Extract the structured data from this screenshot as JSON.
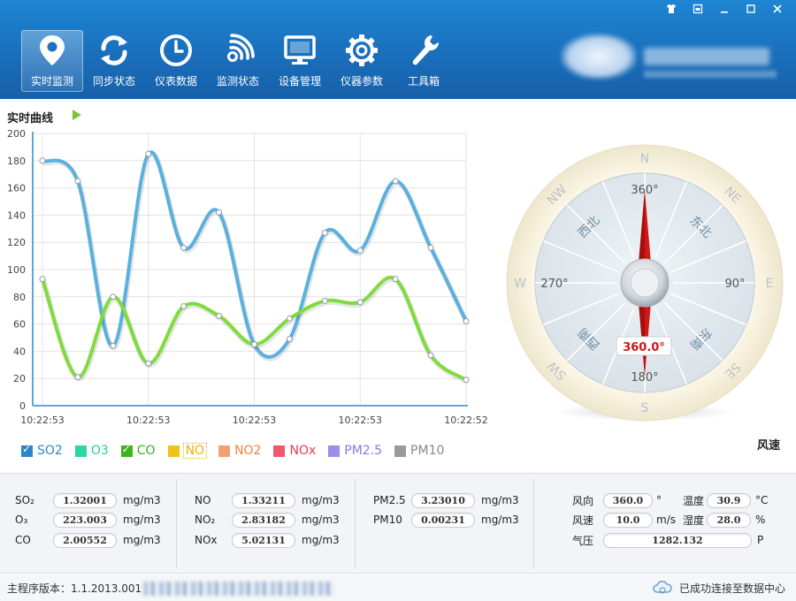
{
  "window_controls": [
    "shirt-icon",
    "restore-small-icon",
    "minimize-icon",
    "maximize-icon",
    "close-icon"
  ],
  "toolbar": {
    "items": [
      {
        "label": "实时监测",
        "icon": "location-pin-icon",
        "active": true
      },
      {
        "label": "同步状态",
        "icon": "sync-icon",
        "active": false
      },
      {
        "label": "仪表数据",
        "icon": "clock-icon",
        "active": false
      },
      {
        "label": "监测状态",
        "icon": "signal-icon",
        "active": false
      },
      {
        "label": "设备管理",
        "icon": "monitor-icon",
        "active": false
      },
      {
        "label": "仪器参数",
        "icon": "gear-icon",
        "active": false
      },
      {
        "label": "工具箱",
        "icon": "wrench-icon",
        "active": false
      }
    ]
  },
  "section_title": "实时曲线",
  "chart_data": {
    "type": "line",
    "title": "",
    "x": [
      "10:22:53",
      "",
      "",
      "",
      "",
      "",
      "",
      "",
      "",
      "",
      "",
      "",
      "",
      "",
      "",
      "",
      ""
    ],
    "x_tick_labels": [
      "10:22:53",
      "10:22:53",
      "10:22:53",
      "10:22:53",
      "10:22:52"
    ],
    "ylim": [
      0,
      200
    ],
    "yticks": [
      0,
      20,
      40,
      60,
      80,
      100,
      120,
      140,
      160,
      180,
      200
    ],
    "grid": true,
    "series": [
      {
        "name": "SO2",
        "color": "#5ab0de",
        "values": [
          180,
          165,
          44,
          185,
          116,
          142,
          45,
          49,
          127,
          114,
          165,
          116,
          62
        ]
      },
      {
        "name": "CO",
        "color": "#7fdc3c",
        "values": [
          93,
          21,
          80,
          31,
          73,
          66,
          45,
          64,
          77,
          76,
          93,
          37,
          19
        ]
      }
    ]
  },
  "legend": [
    {
      "name": "SO2",
      "color": "#2e86c8",
      "text_color": "#2e86c8",
      "checked": true
    },
    {
      "name": "O3",
      "color": "#2ed6a0",
      "text_color": "#2ec9a0",
      "checked": false
    },
    {
      "name": "CO",
      "color": "#38b81c",
      "text_color": "#38b81c",
      "checked": true
    },
    {
      "name": "NO",
      "color": "#f2c21a",
      "text_color": "#e8b400",
      "checked": false
    },
    {
      "name": "NO2",
      "color": "#f5a070",
      "text_color": "#f08040",
      "checked": false
    },
    {
      "name": "NOx",
      "color": "#ee5a6a",
      "text_color": "#e84050",
      "checked": false
    },
    {
      "name": "PM2.5",
      "color": "#9a8ee8",
      "text_color": "#8878e0",
      "checked": false
    },
    {
      "name": "PM10",
      "color": "#9a9a9a",
      "text_color": "#888888",
      "checked": false
    }
  ],
  "compass": {
    "directions": {
      "n": "N",
      "ne": "NE",
      "e": "E",
      "se": "SE",
      "s": "S",
      "sw": "SW",
      "w": "W",
      "nw": "NW"
    },
    "inner": {
      "n": "360°",
      "e": "90°",
      "s": "180°",
      "w": "270°",
      "ne": "东北",
      "se": "东南",
      "sw": "西南",
      "nw": "西北"
    },
    "readout": "360.0°",
    "heading_deg": 360.0
  },
  "wind_speed_label": "风速",
  "panel": {
    "col1": [
      {
        "label": "SO₂",
        "value": "1.32001",
        "unit": "mg/m3"
      },
      {
        "label": "O₃",
        "value": "223.003",
        "unit": "mg/m3"
      },
      {
        "label": "CO",
        "value": "2.00552",
        "unit": "mg/m3"
      }
    ],
    "col2": [
      {
        "label": "NO",
        "value": "1.33211",
        "unit": "mg/m3"
      },
      {
        "label": "NO₂",
        "value": "2.83182",
        "unit": "mg/m3"
      },
      {
        "label": "NOx",
        "value": "5.02131",
        "unit": "mg/m3"
      }
    ],
    "col3": [
      {
        "label": "PM2.5",
        "value": "3.23010",
        "unit": "mg/m3"
      },
      {
        "label": "PM10",
        "value": "0.00231",
        "unit": "mg/m3"
      }
    ],
    "weather": {
      "wind_dir_label": "风向",
      "wind_dir_value": "360.0",
      "wind_dir_unit": "°",
      "temp_label": "温度",
      "temp_value": "30.9",
      "temp_unit": "°C",
      "wind_speed_label": "风速",
      "wind_speed_value": "10.0",
      "wind_speed_unit": "m/s",
      "humidity_label": "湿度",
      "humidity_value": "28.0",
      "humidity_unit": "%",
      "pressure_label": "气压",
      "pressure_value": "1282.132",
      "pressure_unit": "P"
    }
  },
  "status": {
    "version": "主程序版本：1.1.2013.001",
    "connection": "已成功连接至数据中心"
  }
}
